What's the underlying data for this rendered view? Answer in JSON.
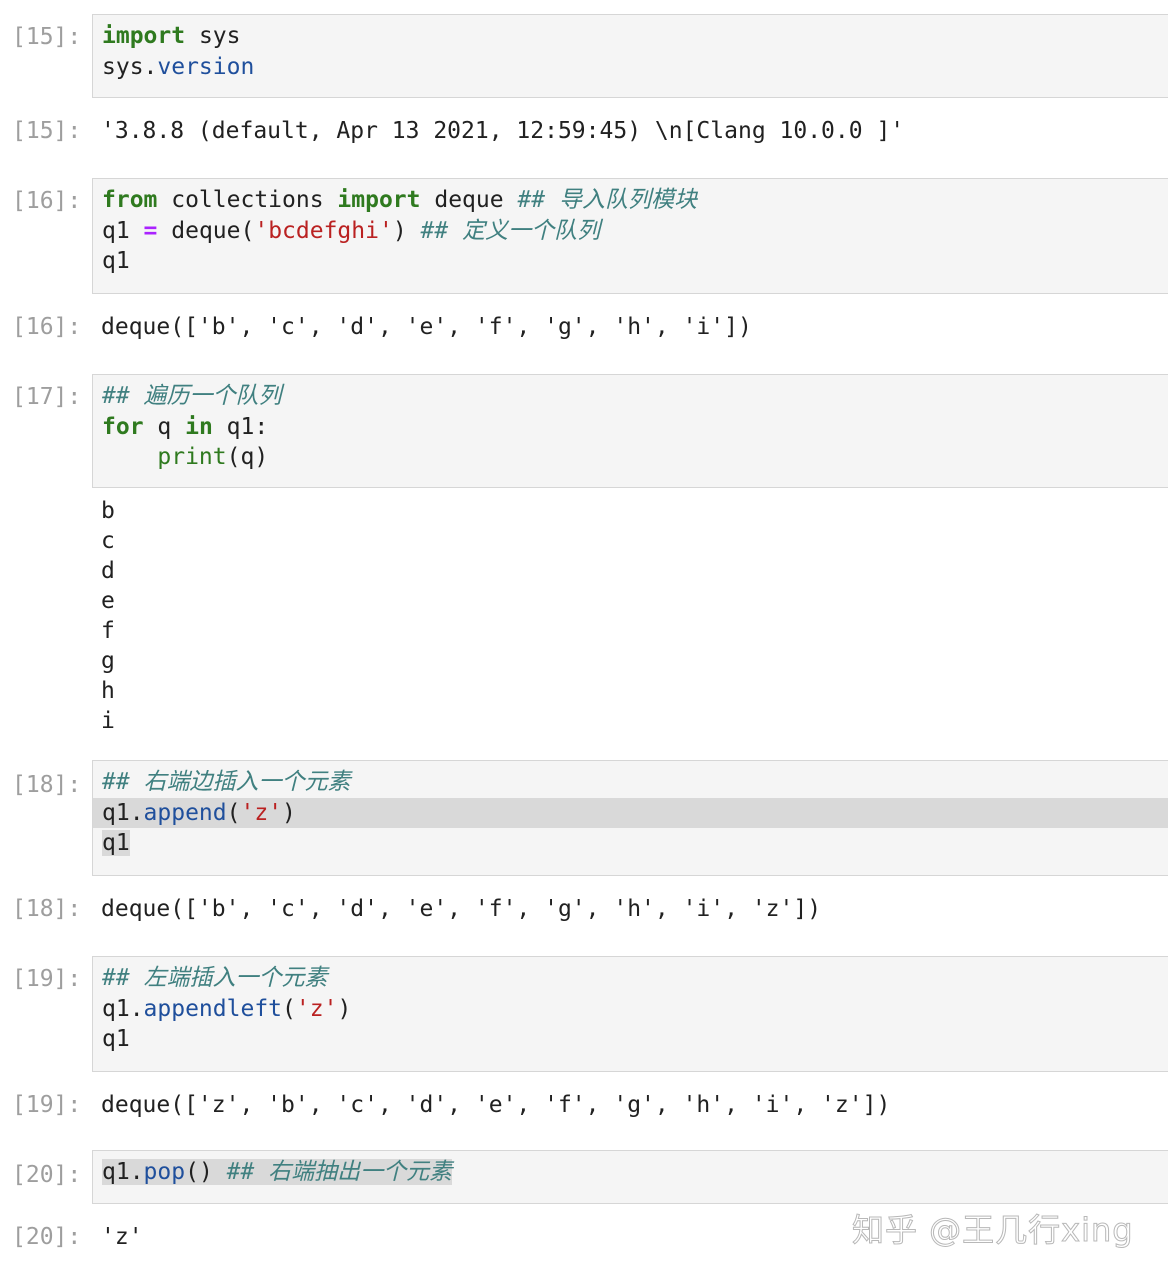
{
  "cells": [
    {
      "prompt": "[15]:",
      "input_lines": [
        [
          {
            "t": "import",
            "c": "kw"
          },
          {
            "t": " sys"
          }
        ],
        [
          {
            "t": "sys."
          },
          {
            "t": "version",
            "c": "attr"
          }
        ]
      ],
      "output_prompt": "[15]:",
      "output": "'3.8.8 (default, Apr 13 2021, 12:59:45) \\n[Clang 10.0.0 ]'"
    },
    {
      "prompt": "[16]:",
      "input_lines": [
        [
          {
            "t": "from",
            "c": "kw"
          },
          {
            "t": " collections "
          },
          {
            "t": "import",
            "c": "kw"
          },
          {
            "t": " deque "
          },
          {
            "t": "## 导入队列模块",
            "c": "cm"
          }
        ],
        [
          {
            "t": "q1 "
          },
          {
            "t": "=",
            "c": "op"
          },
          {
            "t": " deque("
          },
          {
            "t": "'bcdefghi'",
            "c": "str"
          },
          {
            "t": ") "
          },
          {
            "t": "## 定义一个队列",
            "c": "cm"
          }
        ],
        [
          {
            "t": "q1"
          }
        ]
      ],
      "output_prompt": "[16]:",
      "output": "deque(['b', 'c', 'd', 'e', 'f', 'g', 'h', 'i'])"
    },
    {
      "prompt": "[17]:",
      "input_lines": [
        [
          {
            "t": "## 遍历一个队列",
            "c": "cm"
          }
        ],
        [
          {
            "t": "for",
            "c": "kw"
          },
          {
            "t": " q "
          },
          {
            "t": "in",
            "c": "kw"
          },
          {
            "t": " q1:"
          }
        ],
        [
          {
            "t": "    "
          },
          {
            "t": "print",
            "c": "bi"
          },
          {
            "t": "(q)"
          }
        ]
      ],
      "stream_output": [
        "b",
        "c",
        "d",
        "e",
        "f",
        "g",
        "h",
        "i"
      ]
    },
    {
      "prompt": "[18]:",
      "input_lines": [
        [
          {
            "t": "## 右端边插入一个元素",
            "c": "cm"
          }
        ],
        [
          {
            "t": "q1."
          },
          {
            "t": "append",
            "c": "attr"
          },
          {
            "t": "("
          },
          {
            "t": "'z'",
            "c": "str"
          },
          {
            "t": ")"
          }
        ],
        [
          {
            "t": "q1"
          }
        ]
      ],
      "output_prompt": "[18]:",
      "output": "deque(['b', 'c', 'd', 'e', 'f', 'g', 'h', 'i', 'z'])"
    },
    {
      "prompt": "[19]:",
      "input_lines": [
        [
          {
            "t": "## 左端插入一个元素",
            "c": "cm"
          }
        ],
        [
          {
            "t": "q1."
          },
          {
            "t": "appendleft",
            "c": "attr"
          },
          {
            "t": "("
          },
          {
            "t": "'z'",
            "c": "str"
          },
          {
            "t": ")"
          }
        ],
        [
          {
            "t": "q1"
          }
        ]
      ],
      "output_prompt": "[19]:",
      "output": "deque(['z', 'b', 'c', 'd', 'e', 'f', 'g', 'h', 'i', 'z'])"
    },
    {
      "prompt": "[20]:",
      "input_lines": [
        [
          {
            "t": "q1."
          },
          {
            "t": "pop",
            "c": "attr"
          },
          {
            "t": "() "
          },
          {
            "t": "## 右端抽出一个元素",
            "c": "cm"
          }
        ]
      ],
      "output_prompt": "[20]:",
      "output": "'z'"
    }
  ],
  "watermark": "知乎 @王几行xing",
  "colors": {
    "keyword": "#2f7a1f",
    "string": "#ba2121",
    "comment": "#408080",
    "attribute": "#1f4f9c",
    "operator": "#aa22ff",
    "prompt": "#9e9e9e",
    "cell_bg": "#f5f5f5"
  }
}
